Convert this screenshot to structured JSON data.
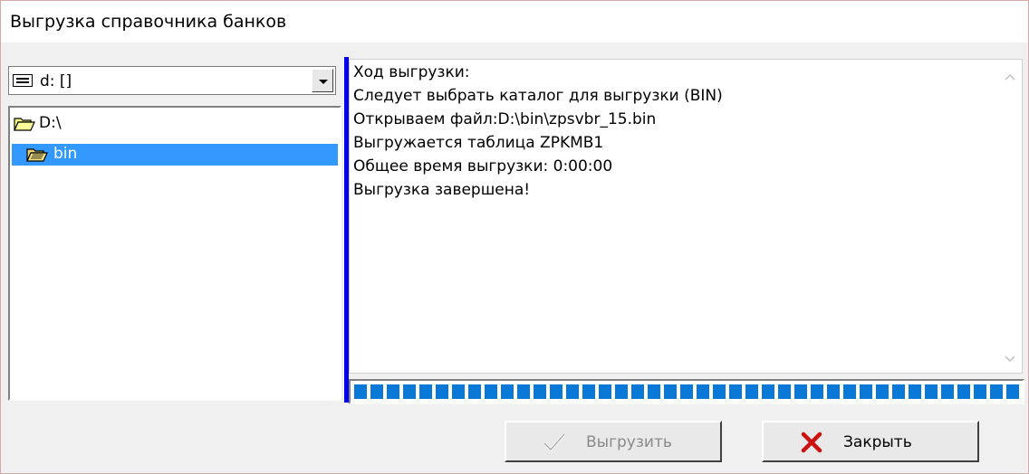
{
  "window": {
    "title": "Выгрузка справочника банков"
  },
  "drive_select": {
    "value": "d: []",
    "icon": "drive-icon"
  },
  "directory_list": {
    "items": [
      {
        "label": "D:\\",
        "icon": "open-folder-icon",
        "selected": false
      },
      {
        "label": "bin",
        "icon": "open-folder-icon",
        "selected": true
      }
    ]
  },
  "log": {
    "lines": [
      "Ход выгрузки:",
      "Следует выбрать каталог для выгрузки (BIN)",
      "Открываем файл:D:\\bin\\zpsvbr_15.bin",
      "Выгружается таблица ZPKMB1",
      "Общее время выгрузки: 0:00:00",
      "Выгрузка завершена!"
    ]
  },
  "progress": {
    "fraction": 1.0,
    "color": "#0a78d7"
  },
  "buttons": {
    "upload": {
      "label": "Выгрузить",
      "enabled": false,
      "icon": "checkmark-icon"
    },
    "close": {
      "label": "Закрыть",
      "enabled": true,
      "icon": "close-x-icon",
      "icon_color": "#cc1111"
    }
  },
  "colors": {
    "selection": "#3399ff",
    "splitter": "#0000ee"
  }
}
